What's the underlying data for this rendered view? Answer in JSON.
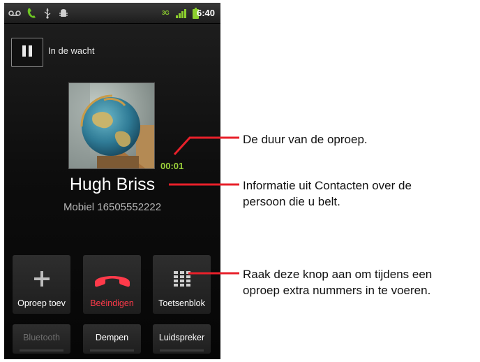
{
  "status_bar": {
    "time": "6:40",
    "icons": [
      "voicemail-icon",
      "phone-call-icon",
      "usb-icon",
      "android-debug-icon",
      "data-3g-icon",
      "signal-icon",
      "battery-icon"
    ],
    "network_label": "3G"
  },
  "call": {
    "hold_label": "In de wacht",
    "duration": "00:01",
    "caller_name": "Hugh Briss",
    "caller_number": "Mobiel 16505552222"
  },
  "buttons": {
    "add_call": "Oproep toev",
    "end_call": "Beëindigen",
    "dialpad": "Toetsenblok",
    "bluetooth": "Bluetooth",
    "mute": "Dempen",
    "speaker": "Luidspreker"
  },
  "colors": {
    "end_call_red": "#ff3a4a",
    "duration_green": "#9bd13a",
    "leader_red": "#e8202a"
  },
  "annotations": {
    "duration": "De duur van de oproep.",
    "contact_line1": "Informatie uit Contacten over de",
    "contact_line2": "persoon die u belt.",
    "dialpad_line1": "Raak deze knop aan om tijdens een",
    "dialpad_line2": "oproep extra nummers in te voeren."
  }
}
